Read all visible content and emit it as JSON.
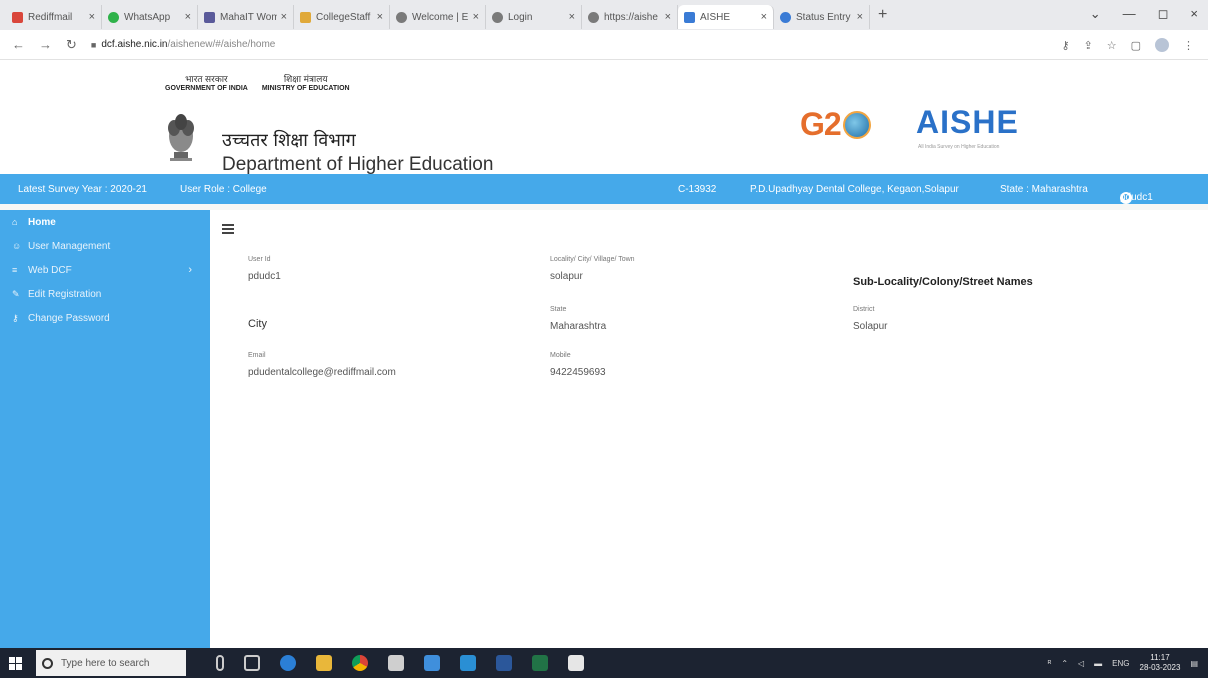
{
  "browser": {
    "tabs": [
      {
        "title": "Rediffmail",
        "color": "#d9463b"
      },
      {
        "title": "WhatsApp",
        "color": "#2fb24a"
      },
      {
        "title": "MahaIT Wom",
        "color": "#5a5a9a"
      },
      {
        "title": "CollegeStaff",
        "color": "#e0a93a"
      },
      {
        "title": "Welcome | E",
        "color": "#7a7a7a"
      },
      {
        "title": "Login",
        "color": "#7a7a7a"
      },
      {
        "title": "https://aishe",
        "color": "#7a7a7a"
      },
      {
        "title": "AISHE",
        "color": "#3a7bd5"
      },
      {
        "title": "Status Entry",
        "color": "#3a7bd5"
      }
    ],
    "tab_close": "×",
    "new_tab": "+",
    "window_controls": [
      "⌄",
      "—",
      "◻",
      "×"
    ],
    "url_domain": "dcf.aishe.nic.in",
    "url_path": "/aishenew/#/aishe/home"
  },
  "header": {
    "gov_hindi": "भारत सरकार",
    "gov_en": "GOVERNMENT OF INDIA",
    "ministry_hindi": "शिक्षा मंत्रालय",
    "ministry_en": "MINISTRY OF EDUCATION",
    "dept_hindi": "उच्चतर शिक्षा विभाग",
    "dept_en": "Department of Higher Education",
    "g20": "G2",
    "aishe": "AISHE",
    "aishe_sub": "All India Survey on Higher Education"
  },
  "infobar": {
    "survey_year": "Latest Survey Year : 2020-21",
    "user_role": "User Role : College",
    "code": "C-13932",
    "college": "P.D.Upadhyay Dental College, Kegaon,Solapur",
    "state": "State : Maharashtra",
    "user": "pdudc1"
  },
  "sidebar": {
    "items": [
      {
        "label": "Home",
        "icon": "home-icon",
        "glyph": "⌂"
      },
      {
        "label": "User Management",
        "icon": "users-icon",
        "glyph": "☺"
      },
      {
        "label": "Web DCF",
        "icon": "list-icon",
        "glyph": "≡"
      },
      {
        "label": "Edit Registration",
        "icon": "edit-icon",
        "glyph": "✎"
      },
      {
        "label": "Change Password",
        "icon": "key-icon",
        "glyph": "⚷"
      }
    ],
    "chevron": "›"
  },
  "profile": {
    "user_id_label": "User Id",
    "user_id": "pdudc1",
    "locality_label": "Locality/ City/ Village/ Town",
    "locality": "solapur",
    "sublocality_head": "Sub-Locality/Colony/Street Names",
    "city_head": "City",
    "state_label": "State",
    "state": "Maharashtra",
    "district_label": "District",
    "district": "Solapur",
    "email_label": "Email",
    "email": "pdudentalcollege@rediffmail.com",
    "mobile_label": "Mobile",
    "mobile": "9422459693"
  },
  "taskbar": {
    "search_placeholder": "Type here to search",
    "lang": "ENG",
    "time": "11:17",
    "date": "28-03-2023"
  }
}
